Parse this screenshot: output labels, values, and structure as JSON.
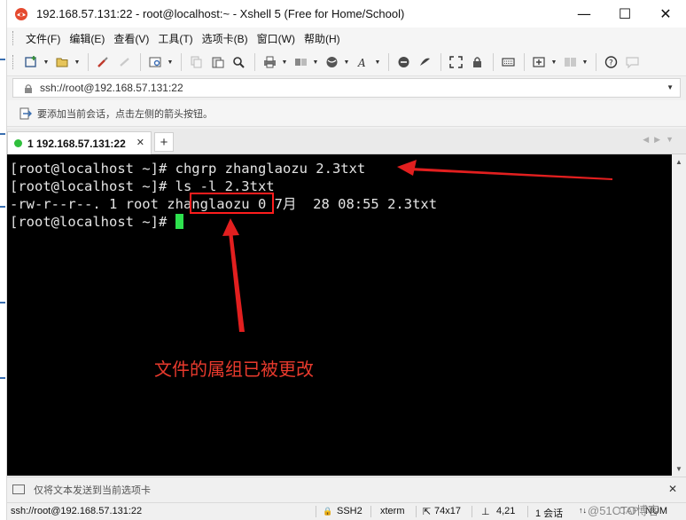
{
  "window": {
    "title": "192.168.57.131:22 - root@localhost:~ - Xshell 5 (Free for Home/School)",
    "controls": {
      "minimize": "—",
      "maximize": "☐",
      "close": "✕"
    }
  },
  "menu": [
    {
      "label": "文件(F)"
    },
    {
      "label": "编辑(E)"
    },
    {
      "label": "查看(V)"
    },
    {
      "label": "工具(T)"
    },
    {
      "label": "选项卡(B)"
    },
    {
      "label": "窗口(W)"
    },
    {
      "label": "帮助(H)"
    }
  ],
  "address_bar": {
    "value": "ssh://root@192.168.57.131:22"
  },
  "hint_bar": {
    "text": "要添加当前会话，点击左侧的箭头按钮。"
  },
  "tabs": [
    {
      "label": "1 192.168.57.131:22",
      "status_color": "#2fbf3c",
      "active": true
    }
  ],
  "tab_add": "+",
  "terminal": {
    "lines": [
      "[root@localhost ~]# chgrp zhanglaozu 2.3txt",
      "[root@localhost ~]# ls -l 2.3txt",
      "-rw-r--r--. 1 root zhanglaozu 0 7月  28 08:55 2.3txt",
      "[root@localhost ~]# "
    ],
    "cursor_color": "#2ee14e",
    "annotation": "文件的属组已被更改",
    "annotation_color": "#e83a2d"
  },
  "send_bar": {
    "text": "仅将文本发送到当前选项卡"
  },
  "status_bar": {
    "connection": "ssh://root@192.168.57.131:22",
    "protocol": "SSH2",
    "terminal_type": "xterm",
    "size": "74x17",
    "cursor_pos": "4,21",
    "sessions": "1 会话",
    "caps": "CAP",
    "num": "NUM"
  },
  "watermark": "@51CTO博客",
  "colors": {
    "accent": "#e21f1f",
    "terminal_bg": "#000000"
  }
}
